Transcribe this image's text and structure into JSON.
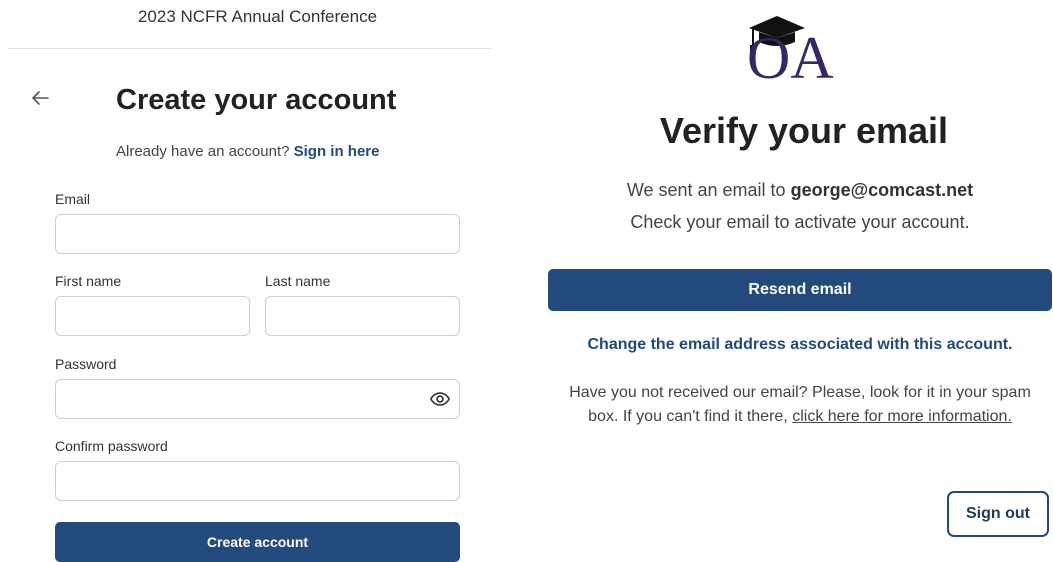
{
  "signup": {
    "conference_title": "2023 NCFR Annual Conference",
    "heading": "Create your account",
    "have_account_text": "Already have an account?",
    "signin_link": "Sign in here",
    "email_label": "Email",
    "email_value": "",
    "first_name_label": "First name",
    "first_name_value": "",
    "last_name_label": "Last name",
    "last_name_value": "",
    "password_label": "Password",
    "password_value": "",
    "confirm_password_label": "Confirm password",
    "confirm_password_value": "",
    "create_button": "Create account"
  },
  "verify": {
    "logo_text": "OA",
    "heading": "Verify your email",
    "sent_prefix": "We sent an email to",
    "email": "george@comcast.net",
    "check_text": "Check your email to activate your account.",
    "resend_button": "Resend email",
    "change_email_link": "Change the email address associated with this account.",
    "help_text": "Have you not received our email? Please, look for it in your spam box. If you can't find it there,",
    "help_link": "click here for more information.",
    "signout_button": "Sign out"
  },
  "colors": {
    "primary": "#234a7c",
    "link": "#1f4a7c",
    "logo": "#2e2a6a"
  },
  "icons": {
    "back": "arrow-left-icon",
    "password_toggle": "eye-icon",
    "logo_cap": "graduation-cap-icon"
  }
}
